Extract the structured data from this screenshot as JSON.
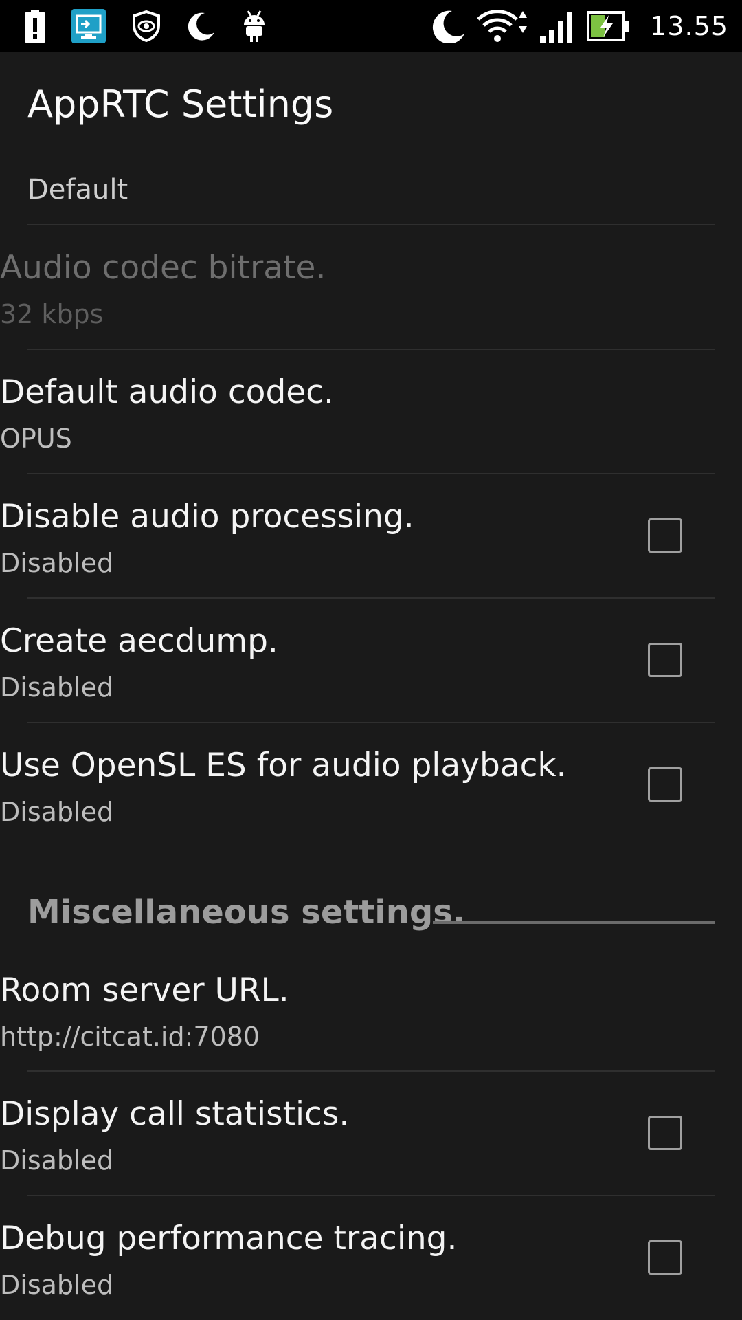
{
  "status_bar": {
    "time": "13.55",
    "left_icons": [
      "alert-battery-icon",
      "screen-share-icon",
      "shield-icon",
      "moon-icon",
      "android-icon"
    ],
    "right_icons": [
      "moon-icon",
      "wifi-icon",
      "cell-signal-icon",
      "battery-charging-icon"
    ]
  },
  "header": {
    "title": "AppRTC Settings"
  },
  "audio_section": {
    "default_label": "Default",
    "items": [
      {
        "title": "Audio codec bitrate.",
        "summary": "32 kbps",
        "enabled": false,
        "has_checkbox": false
      },
      {
        "title": "Default audio codec.",
        "summary": "OPUS",
        "enabled": true,
        "has_checkbox": false
      },
      {
        "title": "Disable audio processing.",
        "summary": "Disabled",
        "enabled": true,
        "has_checkbox": true,
        "checked": false
      },
      {
        "title": "Create aecdump.",
        "summary": "Disabled",
        "enabled": true,
        "has_checkbox": true,
        "checked": false
      },
      {
        "title": "Use OpenSL ES for audio playback.",
        "summary": "Disabled",
        "enabled": true,
        "has_checkbox": true,
        "checked": false
      }
    ]
  },
  "misc_section": {
    "header": "Miscellaneous settings.",
    "items": [
      {
        "title": "Room server URL.",
        "summary": "http://citcat.id:7080",
        "enabled": true,
        "has_checkbox": false
      },
      {
        "title": "Display call statistics.",
        "summary": "Disabled",
        "enabled": true,
        "has_checkbox": true,
        "checked": false
      },
      {
        "title": "Debug performance tracing.",
        "summary": "Disabled",
        "enabled": true,
        "has_checkbox": true,
        "checked": false
      }
    ]
  },
  "colors": {
    "background": "#1a1a1a",
    "status_bar": "#000000",
    "divider": "#2f2f2f",
    "category_text": "#9c9c9c",
    "battery_accent": "#7dc242"
  }
}
